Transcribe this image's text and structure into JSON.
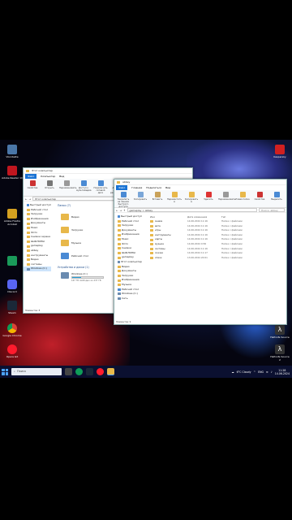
{
  "desktop_icons": [
    {
      "label": "Vkontakte"
    },
    {
      "label": "Adobe Reader 10"
    },
    {
      "label": "Adobe Firefox Acrobat"
    },
    {
      "label": "Discord"
    },
    {
      "label": "Steam"
    },
    {
      "label": "Google Chrome"
    },
    {
      "label": "Opera GX"
    }
  ],
  "desktop_icons_right": [
    {
      "label": "Kaspersky"
    },
    {
      "label": "Half-Life Source"
    },
    {
      "label": "Half-Life Source 2"
    }
  ],
  "left_window": {
    "title": "Этот компьютер",
    "tabs": [
      "Файл",
      "Компьютер",
      "Вид"
    ],
    "ribbon": [
      "Свойства",
      "Открыть",
      "Переименовать",
      "Доступ к мультимедиа",
      "Подключить сетевой диск",
      "Добавить сетевое расположение"
    ],
    "address": "Этот компьютер",
    "nav": [
      "Быстрый доступ",
      "Рабочий стол",
      "Загрузки",
      "Изображения",
      "Документы",
      "Music",
      "Фото",
      "Снимки экрана",
      "ШАБЛОНЫ",
      "gameplay",
      "abbey",
      "инструменты",
      "Видео",
      "системы",
      "Windows (C:)"
    ],
    "folders_header": "Папки (7)",
    "folders": [
      "Видео",
      "Загрузки",
      "Музыка",
      "Рабочий стол"
    ],
    "devices_header": "Устройства и диски (1)",
    "drive_name": "Windows (C:)",
    "drive_free": "167 ГБ свободно из 237 ГБ",
    "drive_fill": 0.3,
    "status": "Элементов: 8"
  },
  "right_window": {
    "title": "abbey",
    "tabs": [
      "Файл",
      "Главная",
      "Поделиться",
      "Вид"
    ],
    "ribbon": [
      "Закрепить на панели быстрого доступа",
      "Копировать",
      "Вставить",
      "Переместить в",
      "Копировать в",
      "Удалить",
      "Переименовать",
      "Новая папка",
      "Свойства",
      "Выделить"
    ],
    "address": "gameplay > abbey",
    "search_placeholder": "Поиск: abbey",
    "columns": [
      "Имя",
      "Дата изменения",
      "Тип"
    ],
    "nav": [
      "Быстрый доступ",
      "Рабочий стол",
      "Загрузки",
      "Документы",
      "Изображения",
      "Music",
      "Фото",
      "Снимки",
      "ШАБЛОНЫ",
      "gameplay",
      "Этот компьютер",
      "Видео",
      "Документы",
      "Загрузки",
      "Изображения",
      "Музыка",
      "Рабочий стол",
      "Windows (C:)",
      "Сеть"
    ],
    "files": [
      {
        "name": "Анимэ",
        "date": "14.06.2024 11:16",
        "type": "Папка с файлами"
      },
      {
        "name": "вата",
        "date": "14.06.2024 11:16",
        "type": "Папка с файлами"
      },
      {
        "name": "игры",
        "date": "14.06.2024 11:16",
        "type": "Папка с файлами"
      },
      {
        "name": "инструменты",
        "date": "14.06.2024 11:16",
        "type": "Папка с файлами"
      },
      {
        "name": "карты",
        "date": "14.06.2024 11:16",
        "type": "Папка с файлами"
      },
      {
        "name": "музыка",
        "date": "14.06.2024 9:56",
        "type": "Папка с файлами"
      },
      {
        "name": "системы",
        "date": "14.06.2024 11:16",
        "type": "Папка с файлами"
      },
      {
        "name": "скачки",
        "date": "14.06.2024 11:17",
        "type": "Папка с файлами"
      },
      {
        "name": "спиок",
        "date": "13.06.2024 20:01",
        "type": "Папка с файлами"
      }
    ],
    "status": "Элементов: 9"
  },
  "taskbar": {
    "search": "Поиск",
    "weather": "6°C Cloudy",
    "lang": "ENG",
    "time": "11:28",
    "date": "14.06.2024"
  },
  "colors": {
    "accent": "#1a73d4",
    "folder": "#e8b84a",
    "taskbar": "#0b1030"
  }
}
